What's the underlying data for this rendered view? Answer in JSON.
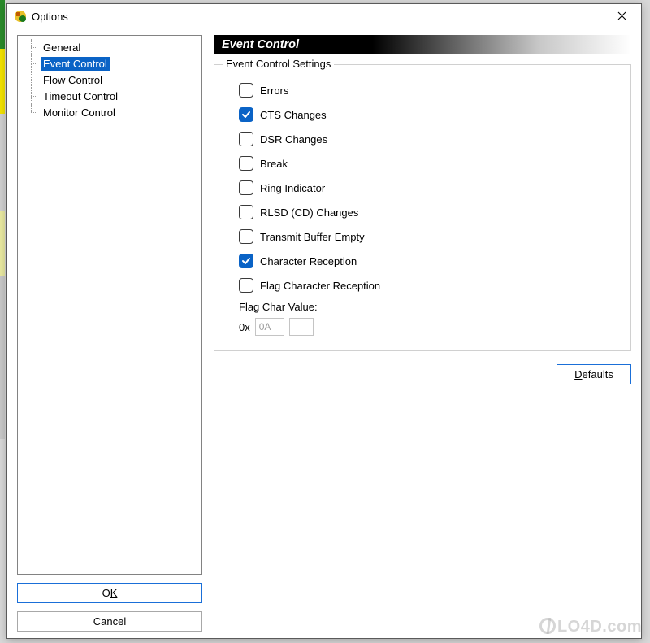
{
  "window": {
    "title": "Options"
  },
  "tree": {
    "items": [
      {
        "label": "General",
        "selected": false
      },
      {
        "label": "Event Control",
        "selected": true
      },
      {
        "label": "Flow Control",
        "selected": false
      },
      {
        "label": "Timeout Control",
        "selected": false
      },
      {
        "label": "Monitor Control",
        "selected": false
      }
    ]
  },
  "buttons": {
    "ok_prefix": "O",
    "ok_u": "K",
    "cancel": "Cancel",
    "defaults_u": "D",
    "defaults_rest": "efaults"
  },
  "section": {
    "header": "Event Control",
    "group_title": "Event Control Settings",
    "checkboxes": [
      {
        "label": "Errors",
        "checked": false
      },
      {
        "label": "CTS Changes",
        "checked": true
      },
      {
        "label": "DSR Changes",
        "checked": false
      },
      {
        "label": "Break",
        "checked": false
      },
      {
        "label": "Ring Indicator",
        "checked": false
      },
      {
        "label": "RLSD (CD) Changes",
        "checked": false
      },
      {
        "label": "Transmit Buffer Empty",
        "checked": false
      },
      {
        "label": "Character Reception",
        "checked": true
      },
      {
        "label": "Flag Character Reception",
        "checked": false
      }
    ],
    "flag_label": "Flag Char Value:",
    "hex_prefix": "0x",
    "hex_value": "0A"
  },
  "watermark": "LO4D.com"
}
